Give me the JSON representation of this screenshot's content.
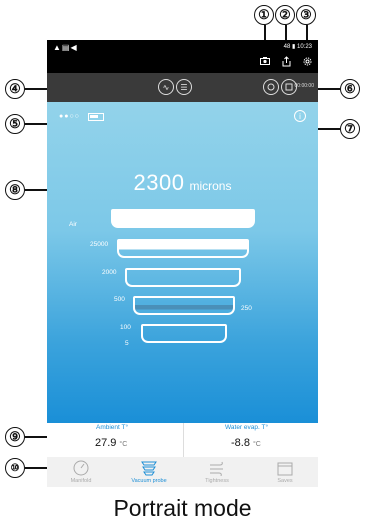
{
  "callouts": [
    "①",
    "②",
    "③",
    "④",
    "⑤",
    "⑥",
    "⑦",
    "⑧",
    "⑨",
    "⑩"
  ],
  "status_bar": {
    "left_icons": "▲▤◀",
    "right_text": "48 ▮ 10:23"
  },
  "header_icons": {
    "camera": "camera-icon",
    "share": "share-icon",
    "settings": "gear-icon"
  },
  "toolbar": {
    "btn_wave": "∿",
    "btn_list": "☰",
    "timer": "00:00:00"
  },
  "main": {
    "conn_dots": "●●○○",
    "info_symbol": "i",
    "reading_value": "2300",
    "reading_unit": "microns",
    "funnel_labels": {
      "air": "Air",
      "l25000": "25000",
      "l2000": "2000",
      "l500": "500",
      "l250": "250",
      "l100": "100",
      "l5": "5"
    }
  },
  "readings": {
    "ambient_label": "Ambient T°",
    "ambient_value": "27.9",
    "ambient_unit": "°C",
    "water_label": "Water evap. T°",
    "water_value": "-8.8",
    "water_unit": "°C"
  },
  "nav": {
    "items": [
      {
        "label": "Manifold",
        "icon": "gauge-icon",
        "glyph": "◔",
        "active": false
      },
      {
        "label": "Vacuum probe",
        "icon": "vacuum-probe-icon",
        "glyph": "☰",
        "active": true
      },
      {
        "label": "Tightness",
        "icon": "wind-icon",
        "glyph": "≋",
        "active": false
      },
      {
        "label": "Saves",
        "icon": "saves-icon",
        "glyph": "▭",
        "active": false
      }
    ]
  },
  "caption": "Portrait mode"
}
